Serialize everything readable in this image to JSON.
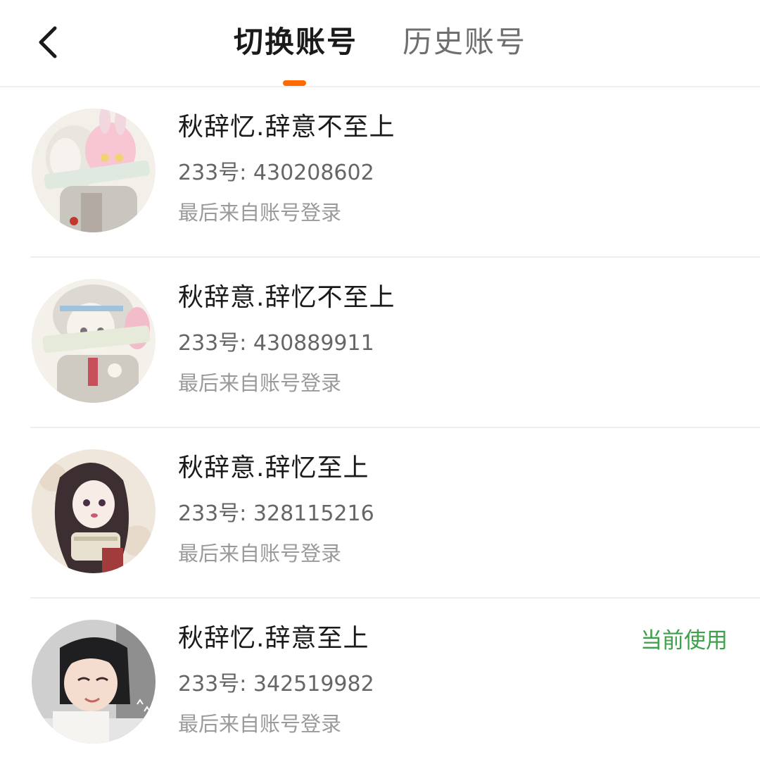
{
  "header": {
    "back_icon": "chevron-left-icon",
    "tabs": [
      {
        "label": "切换账号",
        "active": true
      },
      {
        "label": "历史账号",
        "active": false
      }
    ],
    "accent_color": "#ff6a00"
  },
  "accounts": [
    {
      "name": "秋辞忆.辞意不至上",
      "uid": "233号: 430208602",
      "login_source": "最后来自账号登录",
      "avatar": "anime-avatar-pink-bunny"
    },
    {
      "name": "秋辞意.辞忆不至上",
      "uid": "233号: 430889911",
      "login_source": "最后来自账号登录",
      "avatar": "anime-avatar-grey-hood"
    },
    {
      "name": "秋辞意.辞忆至上",
      "uid": "233号: 328115216",
      "login_source": "最后来自账号登录",
      "avatar": "anime-avatar-dark-hair"
    },
    {
      "name": "秋辞忆.辞意至上",
      "uid": "233号: 342519982",
      "login_source": "最后来自账号登录",
      "avatar": "photo-avatar-girl",
      "status": "当前使用",
      "status_color": "#3ea04a"
    }
  ]
}
